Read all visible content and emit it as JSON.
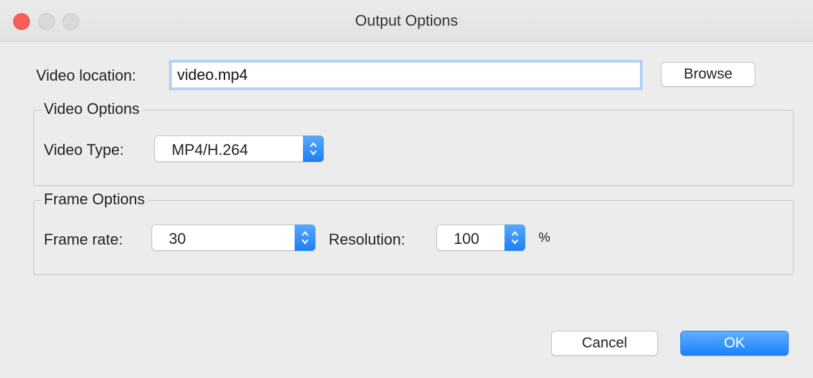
{
  "window": {
    "title": "Output Options",
    "controls": [
      "close",
      "minimize",
      "zoom"
    ]
  },
  "video_location": {
    "label": "Video location:",
    "value": "video.mp4",
    "browse_label": "Browse"
  },
  "video_options": {
    "legend": "Video Options",
    "type_label": "Video Type:",
    "type_value": "MP4/H.264"
  },
  "frame_options": {
    "legend": "Frame Options",
    "frame_rate_label": "Frame rate:",
    "frame_rate_value": "30",
    "resolution_label": "Resolution:",
    "resolution_value": "100",
    "resolution_unit": "%"
  },
  "buttons": {
    "cancel": "Cancel",
    "ok": "OK"
  },
  "colors": {
    "accent": "#1a82fb",
    "close": "#fc5f57",
    "window_bg": "#ececec"
  }
}
